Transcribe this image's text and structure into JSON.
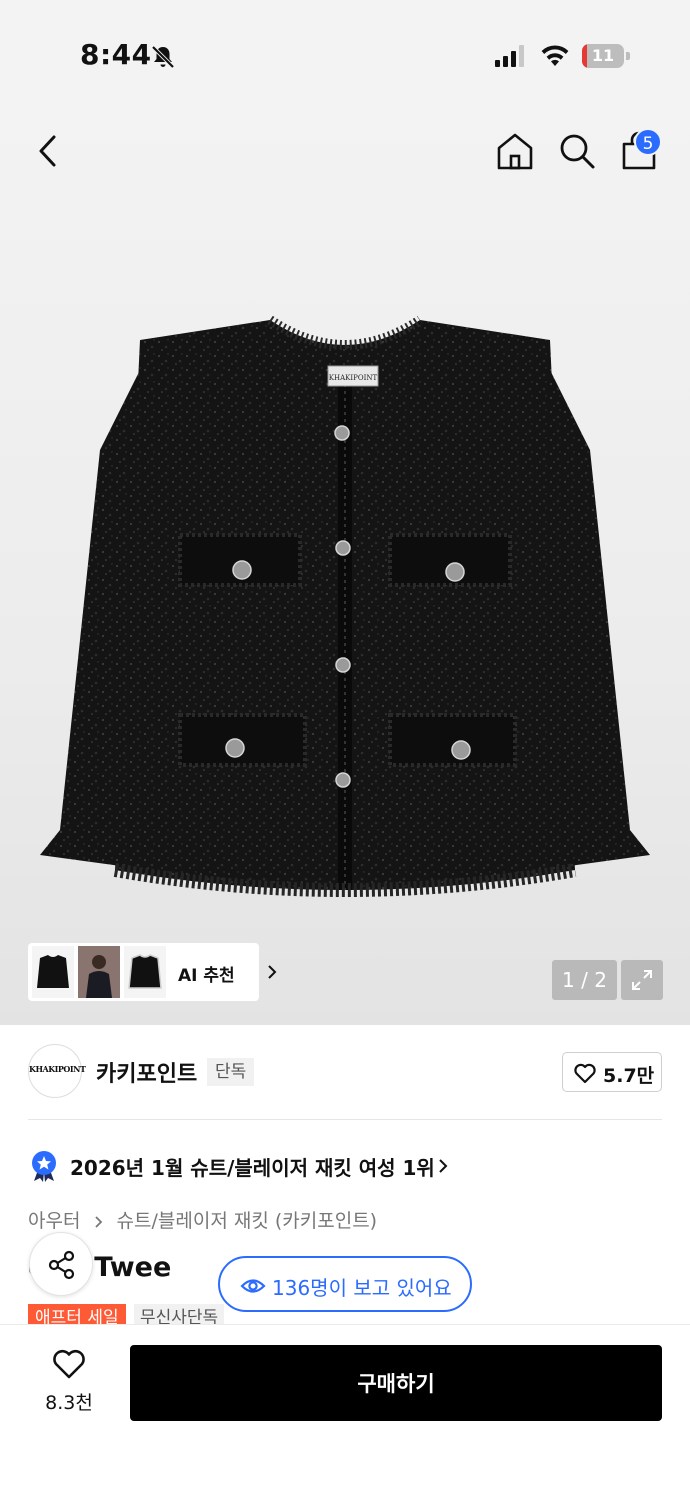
{
  "status_bar": {
    "time": "8:44",
    "battery_level": "11",
    "battery_fraction": 0.11
  },
  "header": {
    "cart_count": "5"
  },
  "gallery": {
    "brand_label_on_jacket": "KHAKIPOINT",
    "ai_recommend_label": "AI 추천",
    "page_indicator": "1 / 2"
  },
  "brand": {
    "logo_text": "KHAKIPOINT",
    "name": "카키포인트",
    "tag": "단독",
    "likes": "5.7만"
  },
  "ranking": {
    "text": "2026년 1월 슈트/블레이저 재킷 여성 1위"
  },
  "breadcrumb": {
    "items": [
      "아우터",
      "슈트/블레이저 재킷 (카키포인트)"
    ]
  },
  "product": {
    "title_visible": "que Twee",
    "viewers_text": "136명이 보고 있어요",
    "tags": [
      "애프터 세일",
      "무신사단독"
    ]
  },
  "bottom_bar": {
    "likes": "8.3천",
    "buy_label": "구매하기"
  },
  "colors": {
    "accent_blue": "#2b6cff",
    "sale_orange": "#ff5a36",
    "buy_black": "#000000"
  }
}
